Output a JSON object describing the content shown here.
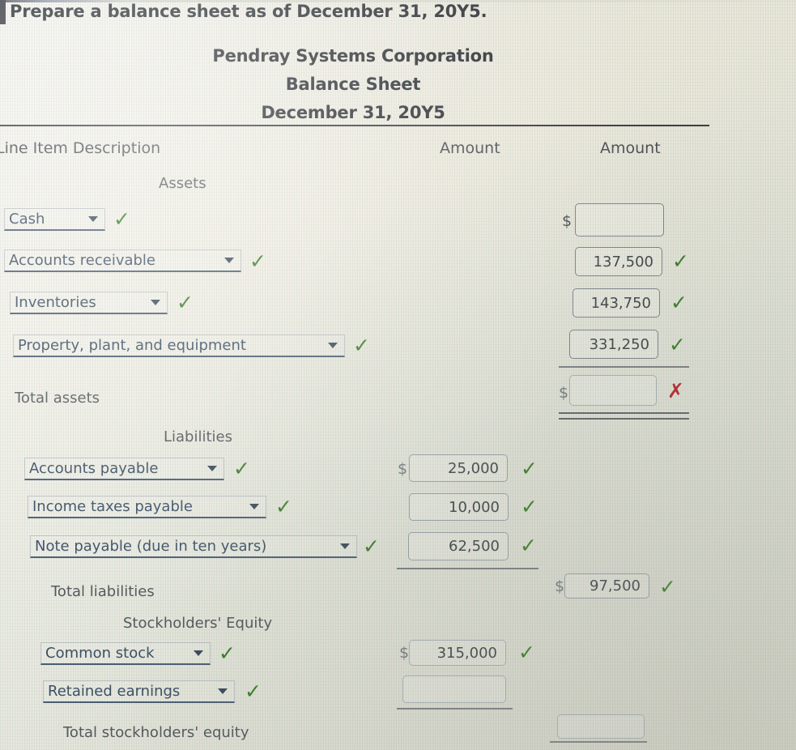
{
  "question": {
    "prompt": "Prepare a balance sheet as of December 31, 20Y5."
  },
  "statement": {
    "company": "Pendray Systems Corporation",
    "title": "Balance Sheet",
    "date": "December 31, 20Y5"
  },
  "columns": {
    "description": "Line Item Description",
    "amount_1": "Amount",
    "amount_2": "Amount"
  },
  "sections": {
    "assets_heading": "Assets",
    "liabilities_heading": "Liabilities",
    "equity_heading": "Stockholders' Equity"
  },
  "currency_symbol": "$",
  "icons": {
    "check": "✓",
    "cross": "✗",
    "caret": "chevron-down-icon"
  },
  "colors": {
    "correct": "#3a7d28",
    "incorrect": "#b8222b",
    "dropdown_underline": "#4a5d74",
    "text": "#4a4e52"
  },
  "rows": {
    "cash": {
      "label": "Cash",
      "label_status": "correct",
      "amount": "",
      "amount_status": "none"
    },
    "accounts_receivable": {
      "label": "Accounts receivable",
      "label_status": "correct",
      "amount": "137,500",
      "amount_status": "correct"
    },
    "inventories": {
      "label": "Inventories",
      "label_status": "correct",
      "amount": "143,750",
      "amount_status": "correct"
    },
    "ppe": {
      "label": "Property, plant, and equipment",
      "label_status": "correct",
      "amount": "331,250",
      "amount_status": "correct"
    },
    "total_assets": {
      "label": "Total assets",
      "amount": "",
      "amount_status": "incorrect"
    },
    "accounts_payable": {
      "label": "Accounts payable",
      "label_status": "correct",
      "amount": "25,000",
      "amount_status": "correct"
    },
    "income_taxes_payable": {
      "label": "Income taxes payable",
      "label_status": "correct",
      "amount": "10,000",
      "amount_status": "correct"
    },
    "note_payable": {
      "label": "Note payable (due in ten years)",
      "label_status": "correct",
      "amount": "62,500",
      "amount_status": "correct"
    },
    "total_liabilities": {
      "label": "Total liabilities",
      "amount": "97,500",
      "amount_status": "correct"
    },
    "common_stock": {
      "label": "Common stock",
      "label_status": "correct",
      "amount": "315,000",
      "amount_status": "correct"
    },
    "retained_earnings": {
      "label": "Retained earnings",
      "label_status": "correct",
      "amount": "",
      "amount_status": "none"
    },
    "total_equity": {
      "label": "Total stockholders' equity",
      "amount": "",
      "amount_status": "none"
    }
  }
}
